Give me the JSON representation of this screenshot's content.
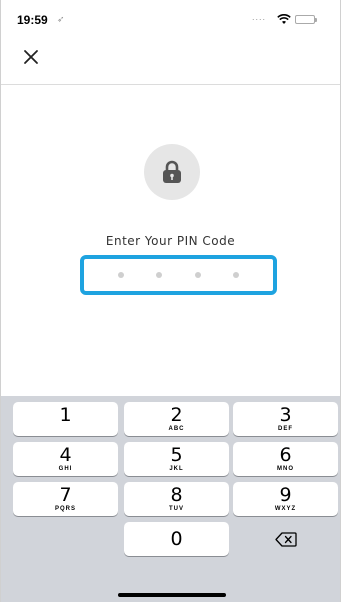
{
  "status_bar": {
    "time": "19:59",
    "signal": "....",
    "battery_color": "#4cd964"
  },
  "header": {
    "close_icon": "close-icon"
  },
  "pin": {
    "lock_icon": "lock-icon",
    "prompt": "Enter Your PIN Code",
    "digits_entered": 0,
    "digits_total": 4,
    "box_color": "#1ea3e0"
  },
  "keypad": {
    "keys": [
      {
        "num": "1",
        "sub": ""
      },
      {
        "num": "2",
        "sub": "ABC"
      },
      {
        "num": "3",
        "sub": "DEF"
      },
      {
        "num": "4",
        "sub": "GHI"
      },
      {
        "num": "5",
        "sub": "JKL"
      },
      {
        "num": "6",
        "sub": "MNO"
      },
      {
        "num": "7",
        "sub": "PQRS"
      },
      {
        "num": "8",
        "sub": "TUV"
      },
      {
        "num": "9",
        "sub": "WXYZ"
      },
      {
        "num": "0",
        "sub": ""
      }
    ],
    "backspace_icon": "backspace-icon"
  }
}
